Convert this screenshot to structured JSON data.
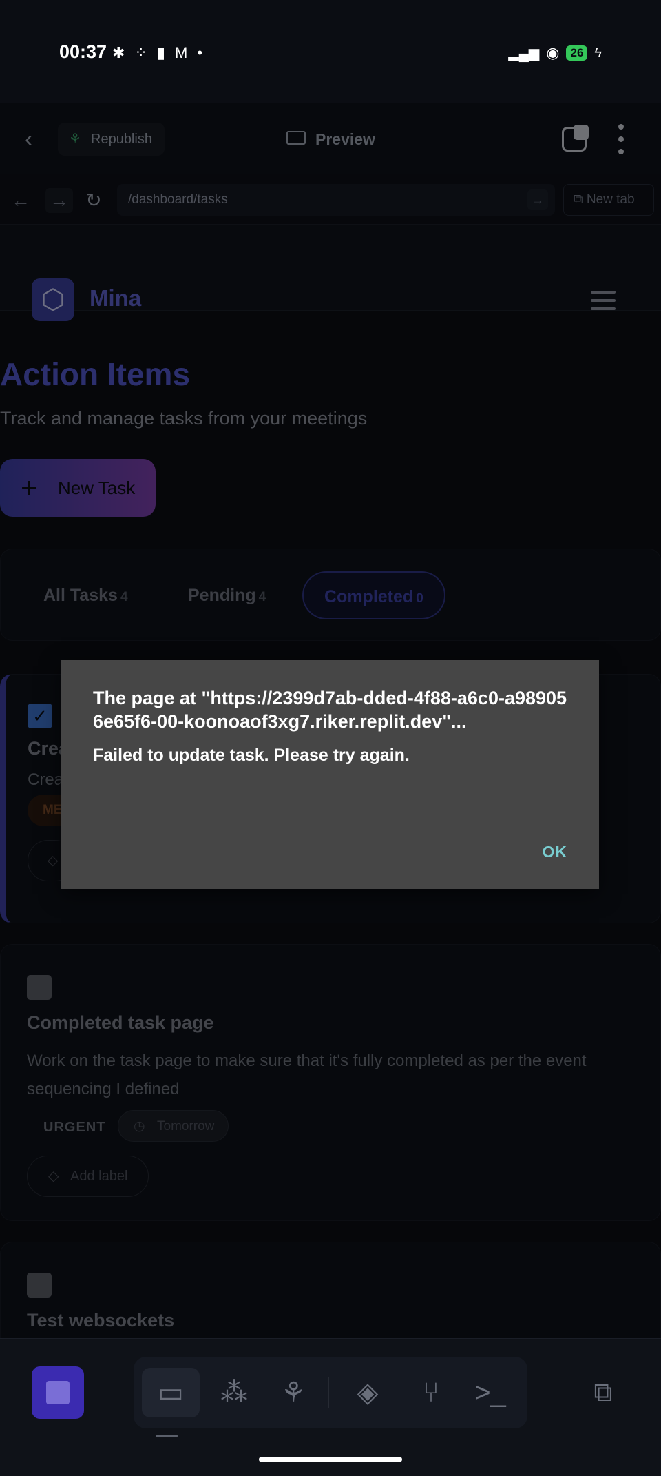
{
  "status_bar": {
    "time": "00:37",
    "notification_icons": [
      "slack-icon",
      "dots-icon",
      "battery-saver-icon",
      "gmail-icon",
      "dot-icon"
    ],
    "battery": "26"
  },
  "top_bar": {
    "republish_label": "Republish",
    "preview_label": "Preview"
  },
  "url_bar": {
    "url": "/dashboard/tasks",
    "new_tab_label": "New tab"
  },
  "app": {
    "brand": "Mina",
    "page_title": "Action Items",
    "page_subtitle": "Track and manage tasks from your meetings",
    "new_task_label": "New Task",
    "filters": [
      {
        "label": "All Tasks",
        "count": "4"
      },
      {
        "label": "Pending",
        "count": "4"
      },
      {
        "label": "Completed",
        "count": "0",
        "active": true
      }
    ],
    "tasks": [
      {
        "title": "Crea",
        "description": "Crea",
        "priority": "ME",
        "checked": true
      },
      {
        "title": "Completed task page",
        "description": "Work on the task page to make sure that it's fully completed as per the event sequencing I defined",
        "priority": "URGENT",
        "due": "Tomorrow",
        "add_label": "Add label",
        "checked": false
      },
      {
        "title": "Test websockets",
        "checked": false
      }
    ]
  },
  "dialog": {
    "title": "The page at \"https://2399d7ab-dded-4f88-a6c0-a989056e65f6-00-koonoaof3xg7.riker.replit.dev\"...",
    "message": "Failed to update task. Please try again.",
    "ok_label": "OK"
  },
  "bottom_toolbar": {
    "items": [
      "desktop-icon",
      "apps-icon",
      "deploy-icon",
      "shell-icon",
      "git-icon",
      "console-icon"
    ]
  }
}
